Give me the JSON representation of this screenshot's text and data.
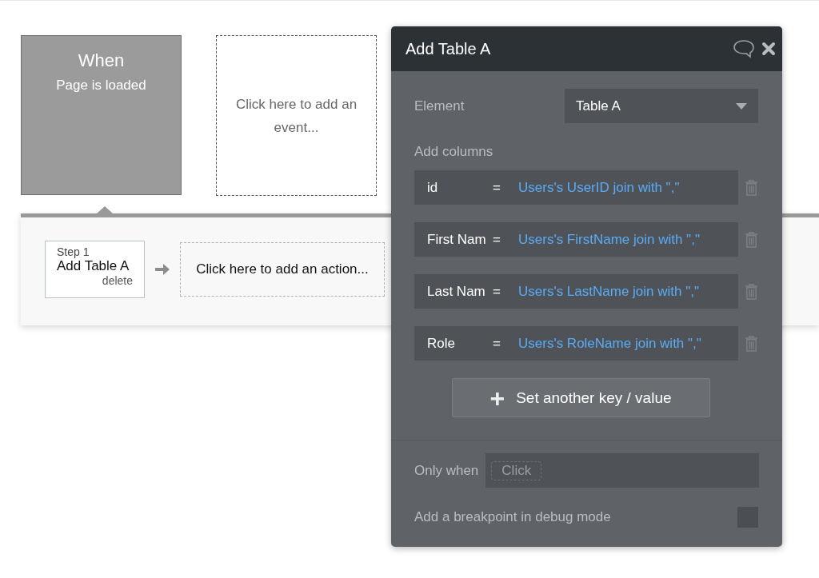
{
  "event": {
    "heading": "When",
    "trigger": "Page is loaded"
  },
  "add_event": {
    "label": "Click here to add an event..."
  },
  "steps": [
    {
      "step": "Step 1",
      "action": "Add Table A",
      "delete": "delete"
    }
  ],
  "add_action": {
    "label": "Click here to add an action..."
  },
  "panel": {
    "title": "Add Table A",
    "element_label": "Element",
    "element_value": "Table A",
    "columns_label": "Add columns",
    "columns": [
      {
        "key": "id",
        "op": "=",
        "value": "Users's UserID join with \",\""
      },
      {
        "key": "First Nam",
        "op": "=",
        "value": "Users's FirstName join with \",\""
      },
      {
        "key": "Last Nam",
        "op": "=",
        "value": "Users's LastName join with \",\""
      },
      {
        "key": "Role",
        "op": "=",
        "value": "Users's RoleName join with \",\""
      }
    ],
    "add_button": {
      "icon": "+",
      "label": "Set another key / value"
    },
    "only_when_label": "Only when",
    "only_when_placeholder": "Click",
    "breakpoint": {
      "label": "Add a breakpoint in debug mode",
      "checked": false
    }
  }
}
